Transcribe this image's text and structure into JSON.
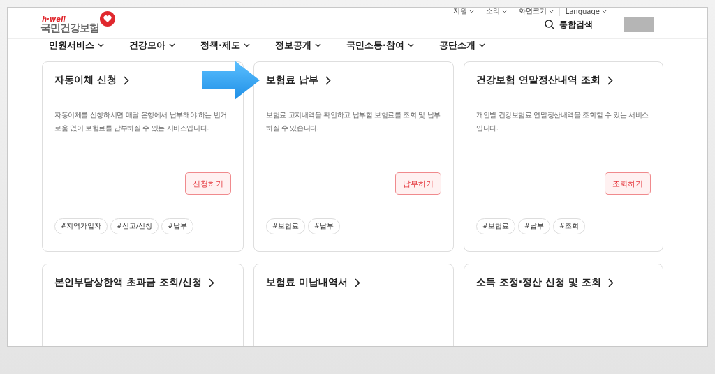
{
  "utility_links": [
    "지원",
    "소리",
    "화면크기",
    "Language"
  ],
  "logo": {
    "tagline": "h·well",
    "name": "국민건강보험"
  },
  "search": {
    "label": "통합검색"
  },
  "nav": [
    "민원서비스",
    "건강모아",
    "정책·제도",
    "정보공개",
    "국민소통·참여",
    "공단소개"
  ],
  "cards": [
    {
      "title": "자동이체 신청",
      "description": "자동이체를 신청하시면 매달 은행에서 납부해야 하는 번거로움 없이 보험료를 납부하실 수 있는 서비스입니다.",
      "button": "신청하기",
      "tags": [
        "#지역가입자",
        "#신고/신청",
        "#납부"
      ]
    },
    {
      "title": "보험료 납부",
      "description": "보험료 고지내역을 확인하고 납부할 보험료를 조회 및 납부하실 수 있습니다.",
      "button": "납부하기",
      "tags": [
        "#보험료",
        "#납부"
      ],
      "highlighted": true
    },
    {
      "title": "건강보험 연말정산내역 조회",
      "description": "개인별 건강보험료 연말정산내역을 조회할 수 있는 서비스입니다.",
      "button": "조회하기",
      "tags": [
        "#보험료",
        "#납부",
        "#조회"
      ]
    },
    {
      "title": "본인부담상한액 초과금 조회/신청"
    },
    {
      "title": "보험료 미납내역서"
    },
    {
      "title": "소득 조정·정산 신청 및 조회"
    }
  ]
}
